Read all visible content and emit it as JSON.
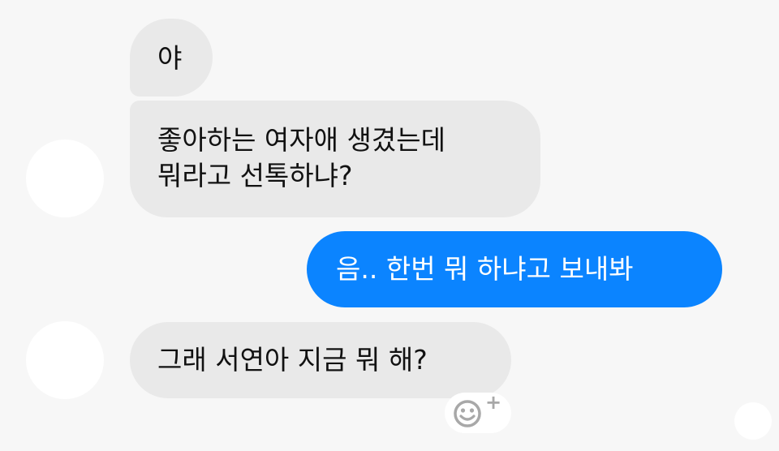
{
  "conversation": {
    "messages": [
      {
        "sender": "other",
        "lines": [
          "야"
        ]
      },
      {
        "sender": "other",
        "lines": [
          "좋아하는 여자애 생겼는데",
          "뭐라고 선톡하냐?"
        ]
      },
      {
        "sender": "me",
        "lines": [
          "음.. 한번 뭐 하냐고 보내봐"
        ]
      },
      {
        "sender": "other",
        "lines": [
          "그래 서연아 지금 뭐 해?"
        ]
      }
    ]
  },
  "reaction_button": {
    "icon": "smiley-add-icon",
    "plus_glyph": "+"
  },
  "colors": {
    "background": "#f7f7f7",
    "incoming_bubble": "#e9e9e9",
    "outgoing_bubble": "#0b84ff",
    "outgoing_text": "#ffffff",
    "icon_gray": "#a8a8a8"
  }
}
